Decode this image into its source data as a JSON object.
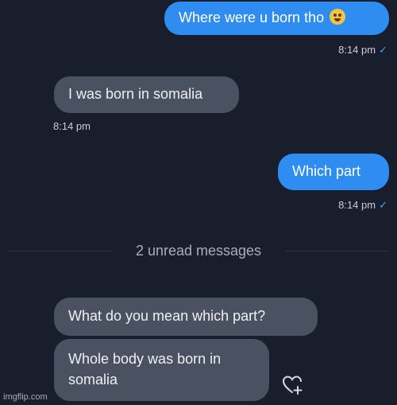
{
  "messages": [
    {
      "direction": "outgoing",
      "text": "Where were u born tho",
      "emoji": "face-with-emoji",
      "time": "8:14 pm",
      "read_mark": "✓"
    },
    {
      "direction": "incoming",
      "text": "I was born in somalia",
      "time": "8:14 pm"
    },
    {
      "direction": "outgoing",
      "text": "Which part",
      "time": "8:14 pm",
      "read_mark": "✓"
    },
    {
      "direction": "incoming",
      "text": "What do you mean which part?"
    },
    {
      "direction": "incoming",
      "text_line1": "Whole body was born in",
      "text_line2": "somalia"
    }
  ],
  "unread_divider": "2 unread messages",
  "watermark": "imgflip.com",
  "colors": {
    "background": "#181e2c",
    "outgoing_bubble": "#2f8cf0",
    "incoming_bubble": "#4a5160",
    "read_check": "#4d9df5"
  },
  "icons": {
    "reaction": "heart-plus-icon"
  }
}
